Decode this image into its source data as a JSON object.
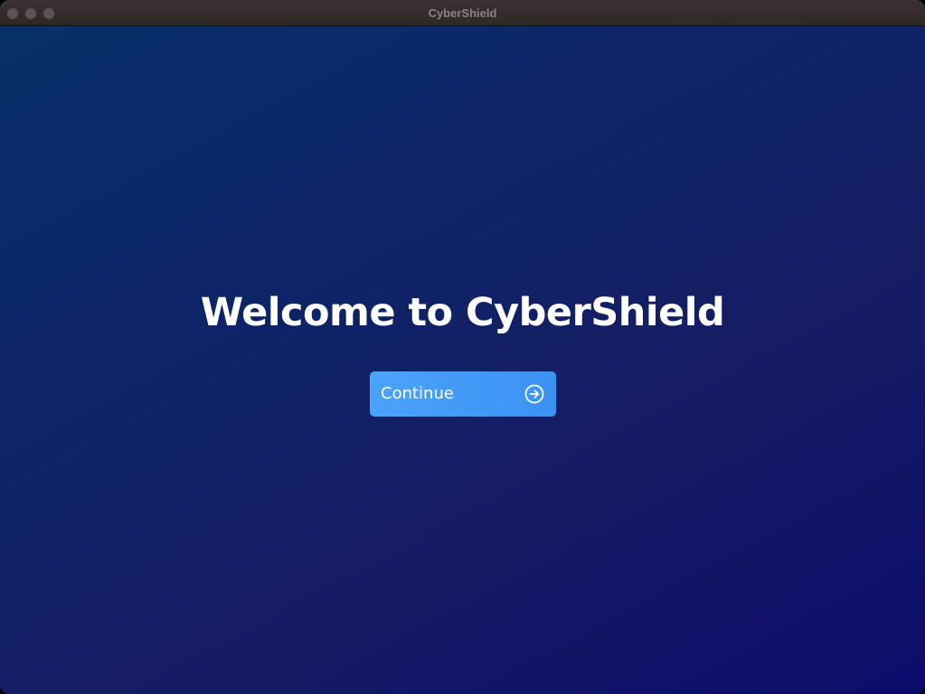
{
  "window": {
    "title": "CyberShield"
  },
  "main": {
    "heading": "Welcome to CyberShield",
    "continue_button": {
      "label": "Continue",
      "icon": "arrow-right-circle-icon"
    }
  },
  "colors": {
    "background_start": "#073068",
    "background_end": "#0b0c6a",
    "button": "#3b92f3",
    "text": "#ffffff"
  }
}
